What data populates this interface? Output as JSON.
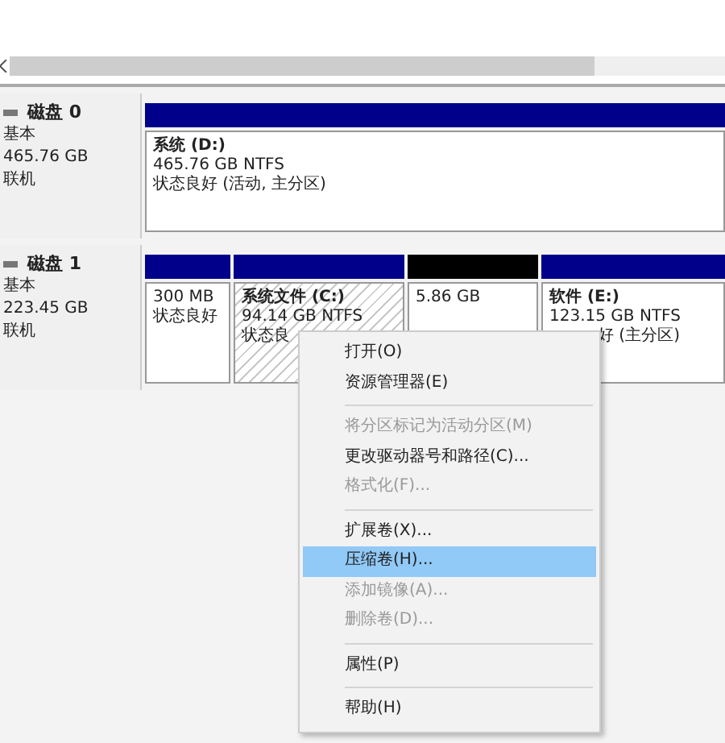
{
  "disks": [
    {
      "name": "磁盘 0",
      "type": "基本",
      "size": "465.76 GB",
      "status": "联机",
      "partitions": [
        {
          "kind": "primary",
          "title": "系统  (D:)",
          "lines": [
            "465.76 GB NTFS",
            "状态良好 (活动, 主分区)"
          ],
          "selected": false
        }
      ]
    },
    {
      "name": "磁盘 1",
      "type": "基本",
      "size": "223.45 GB",
      "status": "联机",
      "partitions": [
        {
          "kind": "primary",
          "lines": [
            "300 MB",
            "状态良好"
          ],
          "selected": false
        },
        {
          "kind": "primary",
          "title": "系统文件  (C:)",
          "lines": [
            "94.14 GB NTFS",
            "状态良"
          ],
          "selected": true
        },
        {
          "kind": "unallocated",
          "lines": [
            "5.86 GB"
          ],
          "selected": false
        },
        {
          "kind": "primary",
          "title": "软件  (E:)",
          "lines": [
            "123.15 GB NTFS",
            "好 (主分区)"
          ],
          "selected": false,
          "overlapped": true
        }
      ]
    }
  ],
  "context_menu": [
    {
      "kind": "item",
      "label": "打开(O)",
      "disabled": false,
      "selected": false
    },
    {
      "kind": "item",
      "label": "资源管理器(E)",
      "disabled": false,
      "selected": false
    },
    {
      "kind": "separator"
    },
    {
      "kind": "item",
      "label": "将分区标记为活动分区(M)",
      "disabled": true,
      "selected": false
    },
    {
      "kind": "item",
      "label": "更改驱动器号和路径(C)...",
      "disabled": false,
      "selected": false
    },
    {
      "kind": "item",
      "label": "格式化(F)...",
      "disabled": true,
      "selected": false
    },
    {
      "kind": "separator"
    },
    {
      "kind": "item",
      "label": "扩展卷(X)...",
      "disabled": false,
      "selected": false
    },
    {
      "kind": "item",
      "label": "压缩卷(H)...",
      "disabled": false,
      "selected": true
    },
    {
      "kind": "item",
      "label": "添加镜像(A)...",
      "disabled": true,
      "selected": false
    },
    {
      "kind": "item",
      "label": "删除卷(D)...",
      "disabled": true,
      "selected": false
    },
    {
      "kind": "separator"
    },
    {
      "kind": "item",
      "label": "属性(P)",
      "disabled": false,
      "selected": false
    },
    {
      "kind": "separator"
    },
    {
      "kind": "item",
      "label": "帮助(H)",
      "disabled": false,
      "selected": false
    }
  ]
}
